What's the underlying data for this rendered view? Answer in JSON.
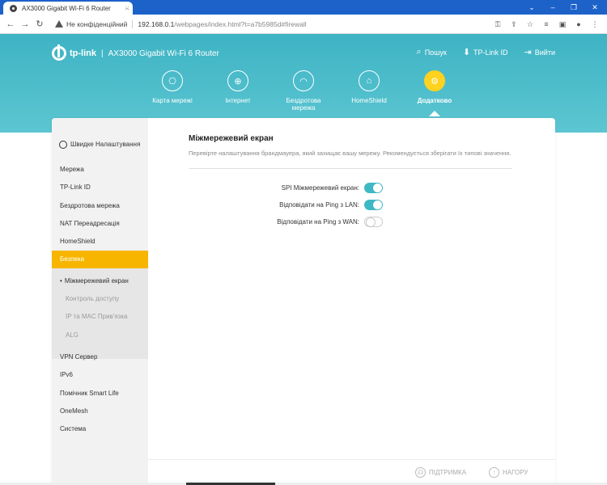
{
  "browser": {
    "tab_title": "AX3000 Gigabit Wi-Fi 6 Router",
    "tab_close": "×",
    "new_tab": "+",
    "security_label": "Не конфіденційний",
    "url_host": "192.168.0.1",
    "url_path": "/webpages/index.html?t=a7b5985d#firewall",
    "nav": {
      "back": "←",
      "forward": "→",
      "reload": "↻"
    },
    "window_controls": {
      "chevron": "⌄",
      "minimize": "–",
      "maximize": "❐",
      "close": "✕"
    },
    "toolbar_icons": {
      "key": "⚿",
      "share": "⇪",
      "star": "☆",
      "reading": "≡",
      "split": "▣",
      "profile": "●",
      "menu": "⋮"
    }
  },
  "header": {
    "brand": "tp-link",
    "divider": "|",
    "model": "AX3000 Gigabit Wi-Fi 6 Router",
    "links": [
      {
        "label": "Пошук",
        "icon": "search-icon",
        "glyph": "⌕"
      },
      {
        "label": "TP-Link ID",
        "icon": "cloud-user-icon",
        "glyph": "⬇"
      },
      {
        "label": "Вийти",
        "icon": "logout-icon",
        "glyph": "⇥"
      }
    ]
  },
  "main_nav": [
    {
      "label": "Карта мережі",
      "glyph": "⎔",
      "active": false
    },
    {
      "label": "Інтернет",
      "glyph": "⊕",
      "active": false
    },
    {
      "label": "Бездротова мережа",
      "glyph": "◠",
      "active": false
    },
    {
      "label": "HomeShield",
      "glyph": "⌂",
      "active": false
    },
    {
      "label": "Додатково",
      "glyph": "⚙",
      "active": true
    }
  ],
  "sidebar": {
    "quick_setup": "Швидке Налаштування",
    "items": [
      "Мережа",
      "TP-Link ID",
      "Бездротова мережа",
      "NAT Переадресація",
      "HomeShield",
      "Безпека"
    ],
    "security_sub": [
      "Міжмережевий екран",
      "Контроль доступу",
      "IP та MAC Прив'язка",
      "ALG"
    ],
    "items_after": [
      "VPN Сервер",
      "IPv6",
      "Помічник Smart Life",
      "OneMesh",
      "Система"
    ]
  },
  "panel": {
    "title": "Міжмережевий екран",
    "description": "Перевірте налаштування брандмауера, який захищає вашу мережу. Рекомендується зберігати їх типові значення.",
    "settings": [
      {
        "label": "SPI Міжмережевий екран:",
        "enabled": true
      },
      {
        "label": "Відповідати на Ping з LAN:",
        "enabled": true
      },
      {
        "label": "Відповідати на Ping з WAN:",
        "enabled": false
      }
    ]
  },
  "footer": {
    "support": "ПІДТРИМКА",
    "support_glyph": "☊",
    "top": "НАГОРУ",
    "top_glyph": "↑"
  },
  "colors": {
    "header_teal": "#3eb3c4",
    "accent_yellow": "#f7b500",
    "toggle_on": "#3fb8c5",
    "browser_blue": "#1c62c9"
  }
}
